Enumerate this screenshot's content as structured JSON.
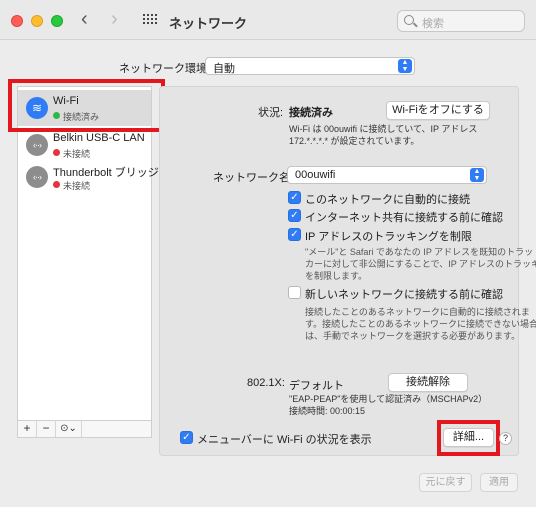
{
  "window": {
    "title": "ネットワーク"
  },
  "search": {
    "placeholder": "検索"
  },
  "location": {
    "label": "ネットワーク環境:",
    "value": "自動"
  },
  "sidebar": {
    "items": [
      {
        "name": "Wi-Fi",
        "status": "接続済み",
        "status_color": "#2fb84a",
        "icon": "wifi-icon"
      },
      {
        "name": "Belkin USB-C LAN",
        "status": "未接続",
        "status_color": "#e5333a",
        "icon": "ethernet-icon"
      },
      {
        "name": "Thunderbolt ブリッジ",
        "status": "未接続",
        "status_color": "#e5333a",
        "icon": "ethernet-icon"
      }
    ],
    "toolbar": {
      "add": "+",
      "remove": "−",
      "more": "⊙⌄"
    }
  },
  "detail": {
    "status_label": "状況:",
    "status_value": "接続済み",
    "wifi_off_button": "Wi-Fiをオフにする",
    "status_desc_1": "Wi-Fi は 00ouwifi に接続していて、IP アドレス",
    "status_desc_2": "172.*.*.*.* が設定されています。",
    "network_name_label": "ネットワーク名:",
    "network_name_value": "00ouwifi",
    "options": [
      {
        "label": "このネットワークに自動的に接続",
        "checked": true
      },
      {
        "label": "インターネット共有に接続する前に確認",
        "checked": true
      },
      {
        "label": "IP アドレスのトラッキングを制限",
        "checked": true
      }
    ],
    "limit_desc": [
      "\"メール\"と Safari であなたの IP アドレスを既知のトラッ",
      "カーに対して非公開にすることで、IP アドレスのトラッキング",
      "を制限します。"
    ],
    "ask_new": {
      "label": "新しいネットワークに接続する前に確認",
      "checked": false
    },
    "ask_new_desc": [
      "接続したことのあるネットワークに自動的に接続されま",
      "す。接続したことのあるネットワークに接続できない場合",
      "は、手動でネットワークを選択する必要があります。"
    ],
    "dot1x_label": "802.1X:",
    "dot1x_value": "デフォルト",
    "disconnect_button": "接続解除",
    "dot1x_desc_1": "\"EAP-PEAP\"を使用して認証済み（MSCHAPv2）",
    "dot1x_desc_2": "接続時間: 00:00:15",
    "menubar": {
      "label": "メニューバーに Wi-Fi の状況を表示",
      "checked": true
    },
    "advanced_button": "詳細...",
    "help": "?"
  },
  "footer": {
    "revert": "元に戻す",
    "apply": "適用"
  },
  "colors": {
    "accent": "#2f7cf6",
    "highlight": "#e3171e"
  }
}
